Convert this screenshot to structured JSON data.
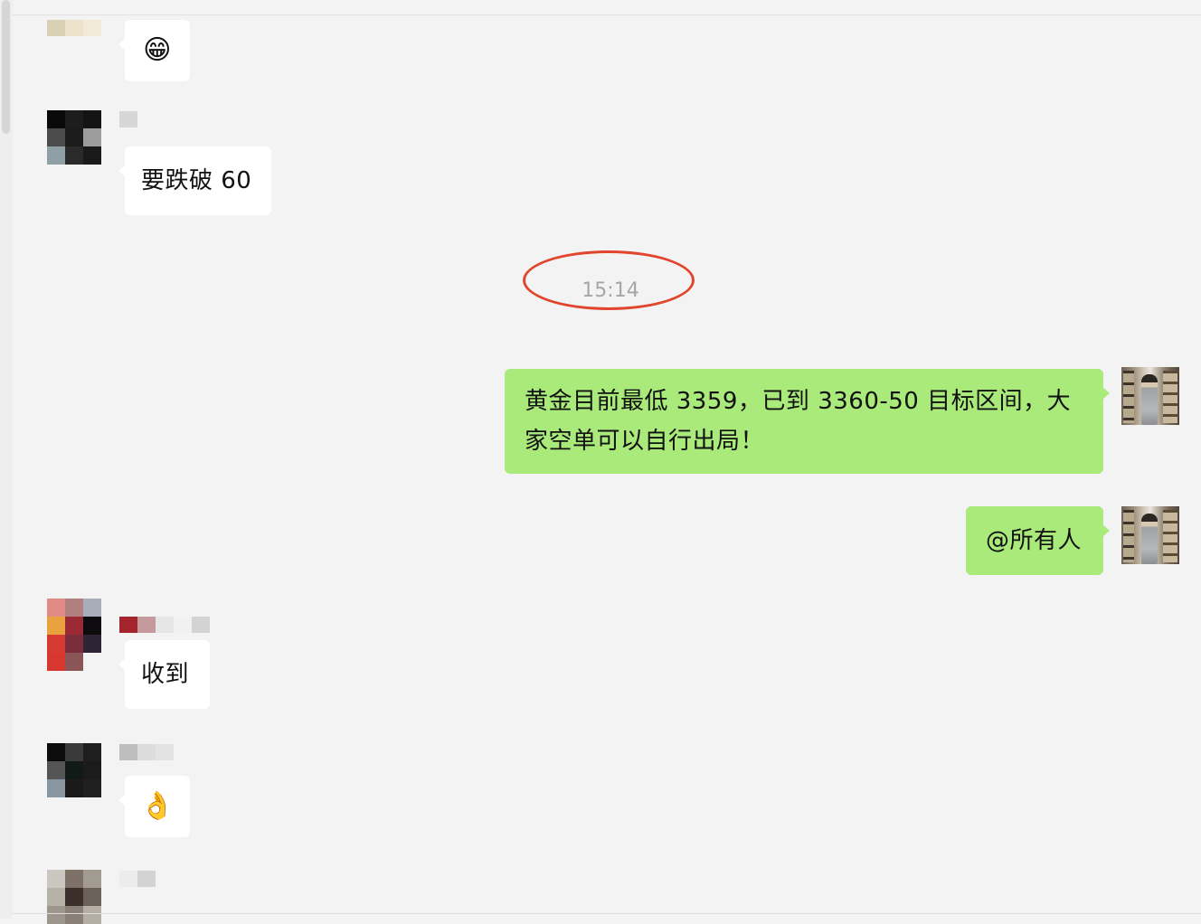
{
  "timestamp": "15:14",
  "messages": [
    {
      "side": "left",
      "type": "emoji",
      "icon": "grinning-face-icon",
      "glyph": "😁"
    },
    {
      "side": "left",
      "type": "text",
      "text": "要跌破 60"
    },
    {
      "side": "right",
      "type": "text",
      "line1": "黄金目前最低 3359，已到 3360-50 目标区间，大",
      "line2": "家空单可以自行出局！"
    },
    {
      "side": "right",
      "type": "text",
      "text": "@所有人"
    },
    {
      "side": "left",
      "type": "text",
      "text": "收到"
    },
    {
      "side": "left",
      "type": "emoji",
      "icon": "ok-hand-icon",
      "glyph": "👌"
    }
  ],
  "colors": {
    "background": "#f3f3f3",
    "incoming_bubble": "#ffffff",
    "outgoing_bubble": "#a9ea7a",
    "timestamp_text": "#a6a6a6",
    "highlight_circle": "#e2452e"
  }
}
